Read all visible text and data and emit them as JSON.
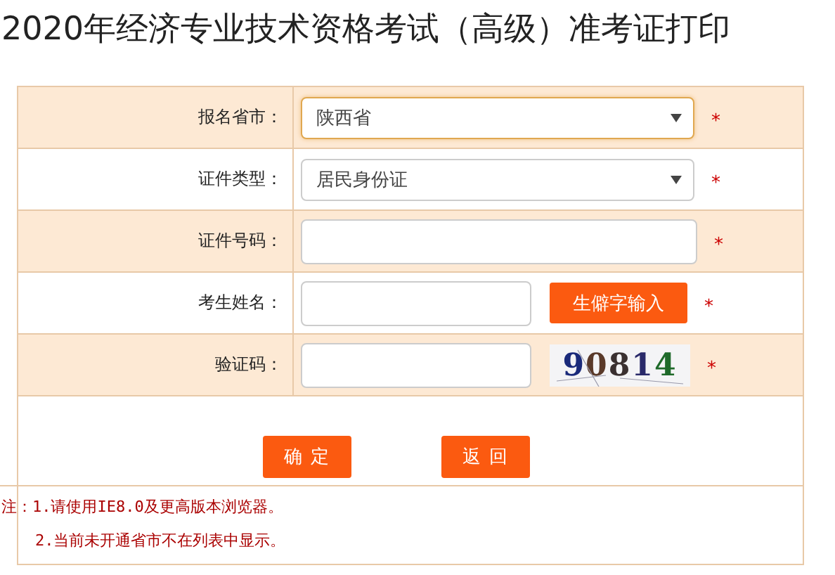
{
  "title": "2020年经济专业技术资格考试（高级）准考证打印",
  "rows": [
    {
      "label": "报名省市：",
      "kind": "select",
      "value": "陕西省",
      "focused": true,
      "required": "*"
    },
    {
      "label": "证件类型：",
      "kind": "select",
      "value": "居民身份证",
      "focused": false,
      "required": "*"
    },
    {
      "label": "证件号码：",
      "kind": "input",
      "required": "*"
    },
    {
      "label": "考生姓名：",
      "kind": "input-button",
      "button": "生僻字输入",
      "required": "*"
    },
    {
      "label": "验证码：",
      "kind": "captcha",
      "captcha": "90814",
      "required": "*"
    }
  ],
  "buttons": [
    "确 定",
    "返 回"
  ],
  "notes": [
    "注：1.请使用IE8.0及更高版本浏览器。",
    "2.当前未开通省市不在列表中显示。"
  ]
}
